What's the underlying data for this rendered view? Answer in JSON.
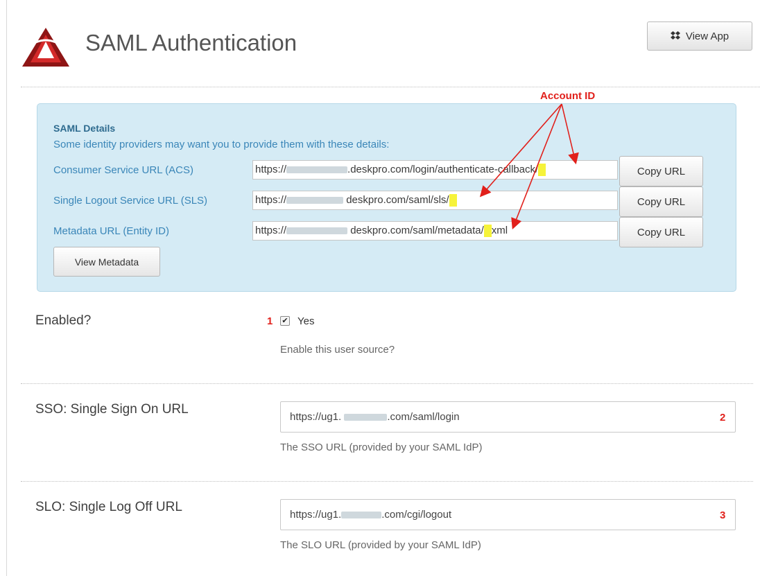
{
  "header": {
    "title": "SAML Authentication",
    "view_app_label": "View App"
  },
  "annotation": {
    "account_id_label": "Account ID"
  },
  "saml_details": {
    "title": "SAML Details",
    "description": "Some identity providers may want you to provide them with these details:",
    "rows": [
      {
        "label": "Consumer Service URL (ACS)",
        "url_prefix": "https://",
        "url_rest": ".deskpro.com/login/authenticate-callback/",
        "url_suffix": "",
        "button": "Copy URL"
      },
      {
        "label": "Single Logout Service URL (SLS)",
        "url_prefix": "https://",
        "url_rest": "deskpro.com/saml/sls/",
        "url_suffix": "",
        "button": "Copy URL"
      },
      {
        "label": "Metadata URL (Entity ID)",
        "url_prefix": "https://",
        "url_rest": "deskpro.com/saml/metadata/",
        "url_suffix": "xml",
        "button": "Copy URL"
      }
    ],
    "view_metadata_label": "View Metadata"
  },
  "settings": {
    "enabled": {
      "label": "Enabled?",
      "marker": "1",
      "checkbox_label": "Yes",
      "checked": true,
      "help": "Enable this user source?"
    },
    "sso": {
      "label": "SSO: Single Sign On URL",
      "value_prefix": "https://ug1.",
      "value_rest": ".com/saml/login",
      "marker": "2",
      "help": "The SSO URL (provided by your SAML IdP)"
    },
    "slo": {
      "label": "SLO: Single Log Off URL",
      "value_prefix": "https://ug1.",
      "value_rest": ".com/cgi/logout",
      "marker": "3",
      "help": "The SLO URL (provided by your SAML IdP)"
    }
  },
  "colors": {
    "annotation": "#e1201b",
    "panel_bg": "#d5ebf5",
    "panel_text": "#3a86b8",
    "highlight": "#f6f33a"
  }
}
